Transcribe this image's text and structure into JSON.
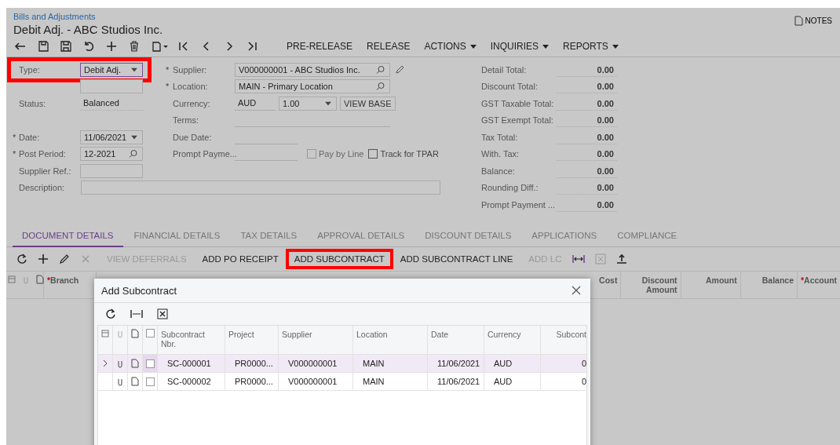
{
  "breadcrumb": "Bills and Adjustments",
  "required_mark": "*",
  "title": "Debit Adj. - ABC Studios Inc.",
  "notes": "NOTES",
  "toolbar": {
    "actions": [
      {
        "label": "PRE-RELEASE",
        "menu": false
      },
      {
        "label": "RELEASE",
        "menu": false
      },
      {
        "label": "ACTIONS",
        "menu": true
      },
      {
        "label": "INQUIRIES",
        "menu": true
      },
      {
        "label": "REPORTS",
        "menu": true
      }
    ]
  },
  "left_fields": [
    {
      "label": "Type:",
      "value": "Debit Adj.",
      "kind": "dropdown",
      "required": false,
      "highlighted": true
    },
    {
      "kind": "hidden"
    },
    {
      "label": "Status:",
      "value": "Balanced",
      "kind": "text",
      "required": false,
      "highlighted": false
    },
    {
      "kind": "spacer"
    },
    {
      "label": "Date:",
      "value": "11/06/2021",
      "kind": "dropdown",
      "required": true,
      "highlighted": false
    },
    {
      "label": "Post Period:",
      "value": "12-2021",
      "kind": "lookup",
      "required": true,
      "highlighted": false
    },
    {
      "label": "Supplier Ref.:",
      "kind": "input",
      "required": false,
      "highlighted": false
    }
  ],
  "middle_fields": [
    {
      "label": "Supplier:",
      "value": "V000000001 - ABC Studios Inc.",
      "kind": "lookup",
      "required": true
    },
    {
      "label": "Location:",
      "value": "MAIN - Primary Location",
      "kind": "lookup",
      "required": true
    },
    {
      "label": "Currency:",
      "kind": "currency",
      "currency": "AUD",
      "rate": "1.00",
      "button": "VIEW BASE",
      "required": false
    },
    {
      "label": "Terms:",
      "kind": "line",
      "required": false
    },
    {
      "label": "Due Date:",
      "kind": "short",
      "required": false
    },
    {
      "label": "Prompt Payme...",
      "kind": "short",
      "required": false
    }
  ],
  "checkboxes": [
    {
      "label": "Pay by Line",
      "checked": false,
      "disabled": true
    },
    {
      "label": "Track for TPAR",
      "checked": false,
      "disabled": false
    }
  ],
  "description": {
    "label": "Description:"
  },
  "totals": [
    {
      "label": "Detail Total:",
      "value": "0.00"
    },
    {
      "label": "Discount Total:",
      "value": "0.00"
    },
    {
      "label": "GST Taxable Total:",
      "value": "0.00"
    },
    {
      "label": "GST Exempt Total:",
      "value": "0.00"
    },
    {
      "label": "Tax Total:",
      "value": "0.00"
    },
    {
      "label": "With. Tax:",
      "value": "0.00"
    },
    {
      "label": "Balance:",
      "value": "0.00"
    },
    {
      "label": "Rounding Diff.:",
      "value": "0.00"
    },
    {
      "label": "Prompt Payment ...",
      "value": "0.00"
    }
  ],
  "tabs": [
    {
      "label": "DOCUMENT DETAILS",
      "selected": true
    },
    {
      "label": "FINANCIAL DETAILS",
      "selected": false
    },
    {
      "label": "TAX DETAILS",
      "selected": false
    },
    {
      "label": "APPROVAL DETAILS",
      "selected": false
    },
    {
      "label": "DISCOUNT DETAILS",
      "selected": false
    },
    {
      "label": "APPLICATIONS",
      "selected": false
    },
    {
      "label": "COMPLIANCE",
      "selected": false
    }
  ],
  "grid_toolbar": [
    {
      "label": "VIEW DEFERRALS",
      "disabled": true,
      "highlighted": false
    },
    {
      "label": "ADD PO RECEIPT",
      "disabled": false,
      "highlighted": false
    },
    {
      "label": "ADD SUBCONTRACT",
      "disabled": false,
      "highlighted": true
    },
    {
      "label": "ADD SUBCONTRACT LINE",
      "disabled": false,
      "highlighted": false
    },
    {
      "label": "ADD LC",
      "disabled": true,
      "highlighted": false
    }
  ],
  "grid_columns_left": [
    {
      "label": "Branch",
      "required": true
    }
  ],
  "grid_columns_right": [
    {
      "label": "Cost",
      "required": false
    },
    {
      "label": "Discount Amount",
      "required": false
    },
    {
      "label": "Amount",
      "required": false
    },
    {
      "label": "Balance",
      "required": false
    },
    {
      "label": "Account",
      "required": true
    }
  ],
  "dialog": {
    "title": "Add Subcontract",
    "columns": [
      "Subcontract Nbr.",
      "Project",
      "Supplier",
      "Location",
      "Date",
      "Currency",
      "Subcont"
    ],
    "all_checked": false,
    "rows": [
      {
        "selected": true,
        "checked": false,
        "cells": [
          "SC-000001",
          "PR0000...",
          "V000000001",
          "MAIN",
          "11/06/2021",
          "AUD",
          "0"
        ]
      },
      {
        "selected": false,
        "checked": false,
        "cells": [
          "SC-000002",
          "PR0000...",
          "V000000001",
          "MAIN",
          "11/06/2021",
          "AUD",
          "0"
        ]
      }
    ]
  }
}
